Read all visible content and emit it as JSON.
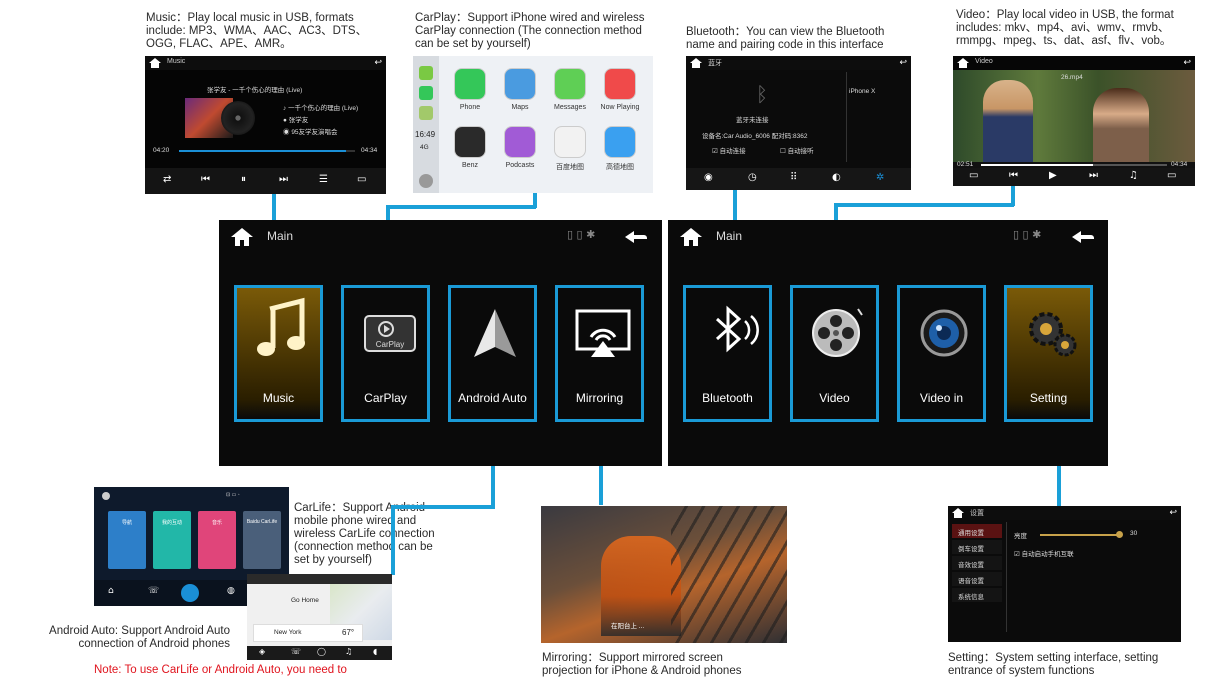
{
  "captions": {
    "music": [
      "Music：Play local music in USB, formats",
      "include: MP3、WMA、AAC、AC3、DTS、",
      "OGG, FLAC、APE、AMR。"
    ],
    "carplay": [
      "CarPlay：Support iPhone wired and wireless",
      "CarPlay connection (The connection method",
      "can be set by yourself)"
    ],
    "bluetooth": [
      "Bluetooth：You can view the Bluetooth",
      "name and pairing code in this interface"
    ],
    "video": [
      "Video：Play local video in USB, the format",
      "includes: mkv、mp4、avi、wmv、rmvb、",
      "rmmpg、mpeg、ts、dat、asf、flv、vob。"
    ],
    "carlife": [
      "CarLife：Support Android",
      "mobile phone wired and",
      "wireless CarLife connection",
      "(connection method can be",
      "set by yourself)"
    ],
    "android_auto": [
      "Android Auto: Support Android Auto",
      "connection of Android phones"
    ],
    "note": "Note: To use CarLife or Android Auto, you need to",
    "mirroring": [
      "Mirroring：Support mirrored screen",
      "projection for iPhone & Android phones"
    ],
    "setting": [
      "Setting：System setting interface, setting",
      "entrance of system functions"
    ]
  },
  "main_left": {
    "title": "Main",
    "tiles": [
      {
        "label": "Music",
        "icon": "music-note-icon"
      },
      {
        "label": "CarPlay",
        "icon": "carplay-icon"
      },
      {
        "label": "Android Auto",
        "icon": "android-auto-icon"
      },
      {
        "label": "Mirroring",
        "icon": "mirroring-icon"
      }
    ]
  },
  "main_right": {
    "title": "Main",
    "tiles": [
      {
        "label": "Bluetooth",
        "icon": "bluetooth-icon"
      },
      {
        "label": "Video",
        "icon": "film-reel-icon"
      },
      {
        "label": "Video in",
        "icon": "camera-lens-icon"
      },
      {
        "label": "Setting",
        "icon": "gears-icon"
      }
    ]
  },
  "music_shot": {
    "title": "Music",
    "song": "张学友 - 一千个伤心的理由 (Live)",
    "track": "一千个伤心的理由 (Live)",
    "artist": "张学友",
    "album": "95友学友演唱会",
    "elapsed": "04:20",
    "total": "04:34",
    "progress": 0.95
  },
  "carplay_shot": {
    "time": "16:49",
    "signal": "4G",
    "apps": [
      "Phone",
      "Maps",
      "Messages",
      "Now Playing",
      "Benz",
      "Podcasts",
      "百度地图",
      "高德地图"
    ]
  },
  "bt_shot": {
    "title": "蓝牙",
    "status": "蓝牙未连接",
    "device_info": "设备名:Car Audio_6006   配对码:8362",
    "opt1": "自动连接",
    "opt2": "自动接听",
    "device": "iPhone X"
  },
  "video_shot": {
    "title": "Video",
    "file": "26.mp4",
    "elapsed": "02:51",
    "total": "04:34",
    "progress": 0.6
  },
  "setting_shot": {
    "title": "设置",
    "menu": [
      "通用设置",
      "倒车设置",
      "音效设置",
      "语音设置",
      "系统信息"
    ],
    "brightness_label": "亮度",
    "brightness_value": "30",
    "auto_label": "自动启动手机互联"
  },
  "carlife_shot": {
    "cards": [
      "导航",
      "我的互动",
      "音乐",
      "Baidu CarLife"
    ]
  },
  "aa_shot": {
    "place1": "Go Home",
    "place2": "New York",
    "temp": "67°"
  },
  "mirror_shot": {
    "caption": "在阳台上 ..."
  }
}
